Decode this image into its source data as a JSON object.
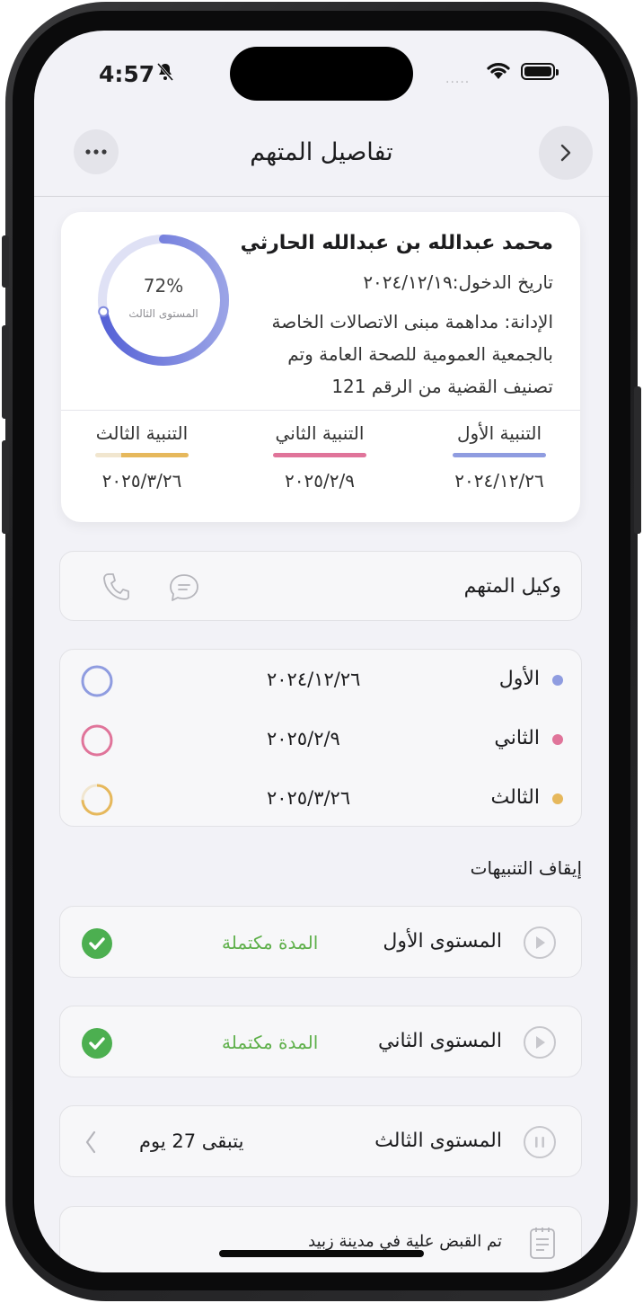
{
  "status_bar": {
    "time": "4:57"
  },
  "nav": {
    "title": "تفاصيل المتهم"
  },
  "profile": {
    "name": "محمد عبدالله بن عبدالله الحارثي",
    "entry_date": "تاريخ الدخول:٢٠٢٤/١٢/١٩",
    "charge": "الإدانة:  مداهمة مبنى الاتصالات الخاصة بالجمعية العمومية للصحة العامة وتم تصنيف القضية من الرقم 121",
    "progress_percent_label": "72%",
    "progress_value": 0.72,
    "progress_level_label": "المستوى الثالث",
    "alerts": [
      {
        "title": "التنبية الأول",
        "date": "٢٠٢٤/١٢/٢٦",
        "color": "#8f9ce0"
      },
      {
        "title": "التنبية الثاني",
        "date": "٢٠٢٥/٢/٩",
        "color": "#e0749a"
      },
      {
        "title": "التنبية الثالث",
        "date": "٢٠٢٥/٣/٢٦",
        "color": "#e6b85c"
      }
    ]
  },
  "agent": {
    "label": "وكيل المتهم"
  },
  "levels": [
    {
      "name": "الأول",
      "date": "٢٠٢٤/١٢/٢٦",
      "color": "#8f9ce0"
    },
    {
      "name": "الثاني",
      "date": "٢٠٢٥/٢/٩",
      "color": "#e0749a"
    },
    {
      "name": "الثالث",
      "date": "٢٠٢٥/٣/٢٦",
      "color": "#e6b85c"
    }
  ],
  "stop_alerts": {
    "title": "إيقاف التنبيهات",
    "items": [
      {
        "label": "المستوى الأول",
        "status": "المدة مكتملة"
      },
      {
        "label": "المستوى الثاني",
        "status": "المدة مكتملة"
      },
      {
        "label": "المستوى الثالث",
        "remaining": "يتبقى 27 يوم"
      }
    ]
  },
  "note": {
    "text": "تم القبض علية في مدينة زبيد"
  }
}
